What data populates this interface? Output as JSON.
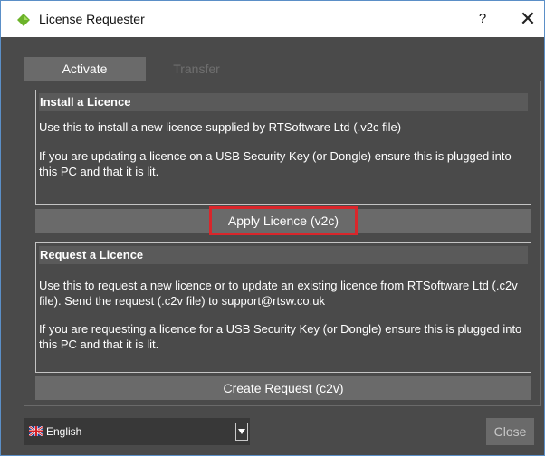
{
  "window": {
    "title": "License Requester",
    "help_label": "?",
    "close_label": "✕"
  },
  "tabs": [
    {
      "label": "Activate",
      "active": true
    },
    {
      "label": "Transfer",
      "active": false
    }
  ],
  "install": {
    "heading": "Install a Licence",
    "text1": "Use this to install a new licence supplied by RTSoftware Ltd (.v2c file)",
    "text2": "If you are updating a licence on a USB Security Key (or Dongle) ensure this is plugged into this PC and that it is lit.",
    "button": "Apply Licence (v2c)"
  },
  "request": {
    "heading": "Request a Licence",
    "text1": "Use this to request a new licence or to update an existing licence from RTSoftware Ltd (.c2v file). Send the request (.c2v file) to support@rtsw.co.uk",
    "text2": "If you are requesting a licence for a USB Security Key (or Dongle) ensure this is plugged into this PC and that it is lit.",
    "button": "Create Request (c2v)"
  },
  "footer": {
    "language": "English",
    "close_button": "Close"
  },
  "colors": {
    "background": "#4a4a4a",
    "highlight_border": "#d9262b",
    "accent_icon": "#6cb32a"
  },
  "icons": {
    "app": "green-diamond-icon",
    "flag": "uk-flag-icon",
    "dropdown": "dropdown-arrow-icon"
  }
}
